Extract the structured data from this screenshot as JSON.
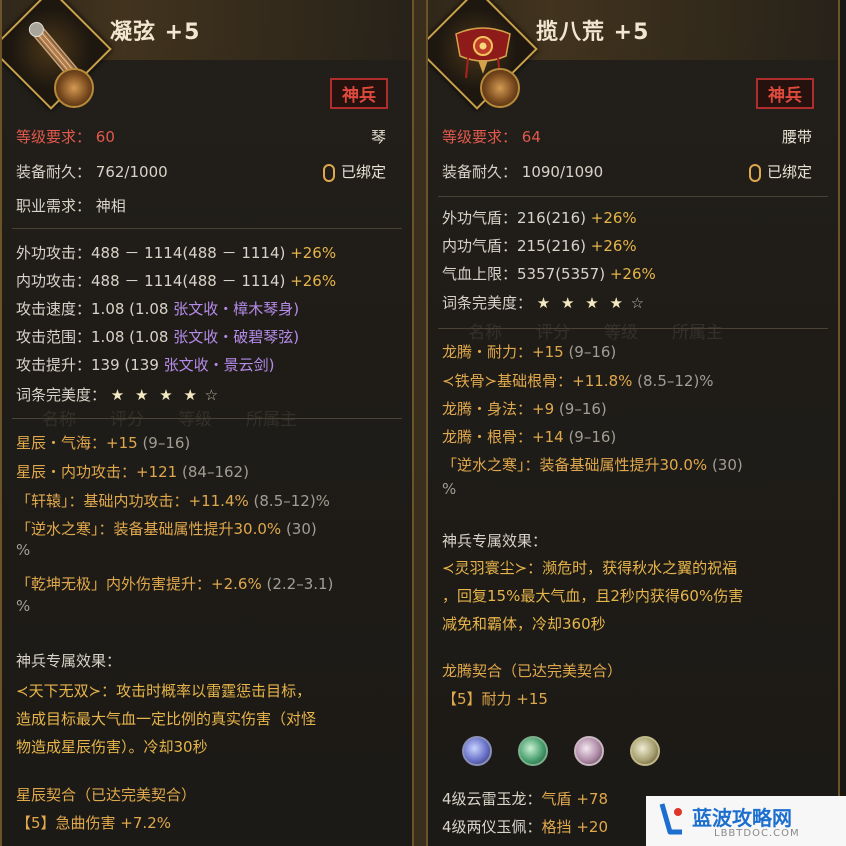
{
  "left": {
    "title": "凝弦 +5",
    "badge": "神兵",
    "level_req_label": "等级要求：",
    "level_req_value": "60",
    "weapon_type": "琴",
    "durability_label": "装备耐久：",
    "durability_value": "762/1000",
    "bound": "已绑定",
    "class_label": "职业需求：",
    "class_value": "神相",
    "stats": [
      {
        "label": "外功攻击：",
        "value": "488 － 1114(488 － 1114)",
        "bonus": "+26%"
      },
      {
        "label": "内功攻击：",
        "value": "488 － 1114(488 － 1114)",
        "bonus": "+26%"
      },
      {
        "label": "攻击速度：",
        "value": "1.08 (1.08 ",
        "extra": "张文收・樟木琴身)"
      },
      {
        "label": "攻击范围：",
        "value": "1.08 (1.08 ",
        "extra": "张文收・破碧琴弦)"
      },
      {
        "label": "攻击提升：",
        "value": "139 (139 ",
        "extra": "张文收・景云剑)"
      }
    ],
    "perfection_label": "词条完美度：",
    "perfection_stars": "★ ★ ★ ★",
    "perfection_empty": "☆",
    "affixes": [
      {
        "name": "星辰・气海：",
        "value": "+15",
        "range": "(9–16)"
      },
      {
        "name": "星辰・内功攻击：",
        "value": "+121",
        "range": "(84–162)"
      },
      {
        "name": "「轩辕」：基础内功攻击：",
        "value": "+11.4%",
        "range": "(8.5–12)%"
      },
      {
        "name": "「逆水之寒」：装备基础属性提升30.0%",
        "value": "",
        "range": "(30)"
      },
      {
        "name": "「乾坤无极」内外伤害提升：",
        "value": "+2.6%",
        "range": "(2.2–3.1)"
      }
    ],
    "affix_pct": "%",
    "affix_pct2": "%",
    "special_title": "神兵专属效果：",
    "special_lines": [
      "≺天下无双≻：攻击时概率以雷霆惩击目标，",
      "造成目标最大气血一定比例的真实伤害（对怪",
      "物造成星辰伤害）。冷却30秒"
    ],
    "pact_title": "星辰契合（已达完美契合）",
    "pact_line": "【5】急曲伤害 +7.2%"
  },
  "right": {
    "title": "揽八荒 +5",
    "badge": "神兵",
    "level_req_label": "等级要求：",
    "level_req_value": "64",
    "item_type": "腰带",
    "durability_label": "装备耐久：",
    "durability_value": "1090/1090",
    "bound": "已绑定",
    "stats": [
      {
        "label": "外功气盾：",
        "value": "216(216)",
        "bonus": "+26%"
      },
      {
        "label": "内功气盾：",
        "value": "215(216)",
        "bonus": "+26%"
      },
      {
        "label": "气血上限：",
        "value": "5357(5357)",
        "bonus": "+26%"
      }
    ],
    "perfection_label": "词条完美度：",
    "perfection_stars": "★ ★ ★ ★",
    "perfection_empty": "☆",
    "affixes": [
      {
        "name": "龙腾・耐力：",
        "value": "+15",
        "range": "(9–16)"
      },
      {
        "name": "≺铁骨≻基础根骨：",
        "value": "+11.8%",
        "range": "(8.5–12)%"
      },
      {
        "name": "龙腾・身法：",
        "value": "+9",
        "range": "(9–16)"
      },
      {
        "name": "龙腾・根骨：",
        "value": "+14",
        "range": "(9–16)"
      },
      {
        "name": "「逆水之寒」：装备基础属性提升30.0%",
        "value": "",
        "range": "(30)"
      }
    ],
    "affix_pct": "%",
    "special_title": "神兵专属效果：",
    "special_lines": [
      "≺灵羽寰尘≻：濒危时，获得秋水之翼的祝福",
      "，回复15%最大气血，且2秒内获得60%伤害",
      "减免和霸体，冷却360秒"
    ],
    "pact_title": "龙腾契合（已达完美契合）",
    "pact_line": "【5】耐力 +15",
    "gems": [
      {
        "name": "4级云雷玉龙：",
        "stat": "气盾",
        "value": "+78"
      },
      {
        "name": "4级两仪玉佩：",
        "stat": "格挡",
        "value": "+20"
      }
    ]
  },
  "watermark": {
    "text": "蓝波攻略网",
    "sub": "LBBTDOC.COM"
  },
  "colors": {
    "red": "#e0594c",
    "gold": "#e6b44a",
    "purple": "#b58be8",
    "frame": "#c9a14a"
  }
}
